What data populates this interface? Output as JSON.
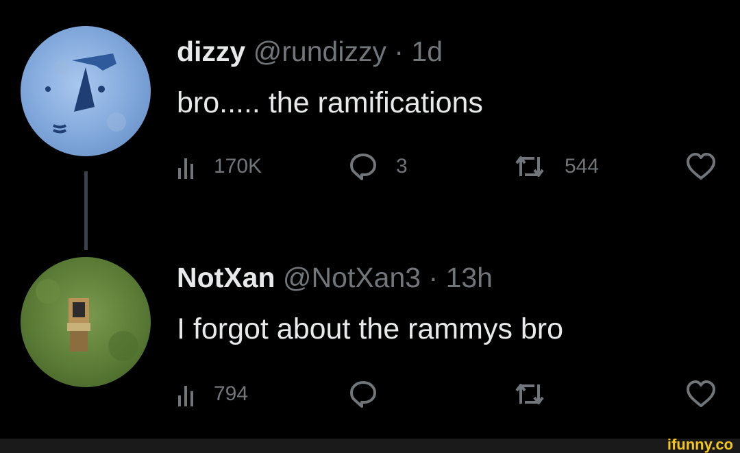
{
  "tweets": [
    {
      "name": "dizzy",
      "handle": "@rundizzy",
      "separator": "·",
      "time": "1d",
      "text": "bro..... the ramifications",
      "views": "170K",
      "replies": "3",
      "retweets": "544",
      "likes": ""
    },
    {
      "name": "NotXan",
      "handle": "@NotXan3",
      "separator": "·",
      "time": "13h",
      "text": "I forgot about the rammys bro",
      "views": "794",
      "replies": "",
      "retweets": "",
      "likes": ""
    }
  ],
  "watermark": "ifunny.co",
  "colors": {
    "background": "#000000",
    "text": "#e7e9ea",
    "muted": "#71767b",
    "thread_line": "#3b4148",
    "watermark": "#f5c518"
  },
  "icons": [
    "views-icon",
    "reply-icon",
    "retweet-icon",
    "like-icon"
  ]
}
